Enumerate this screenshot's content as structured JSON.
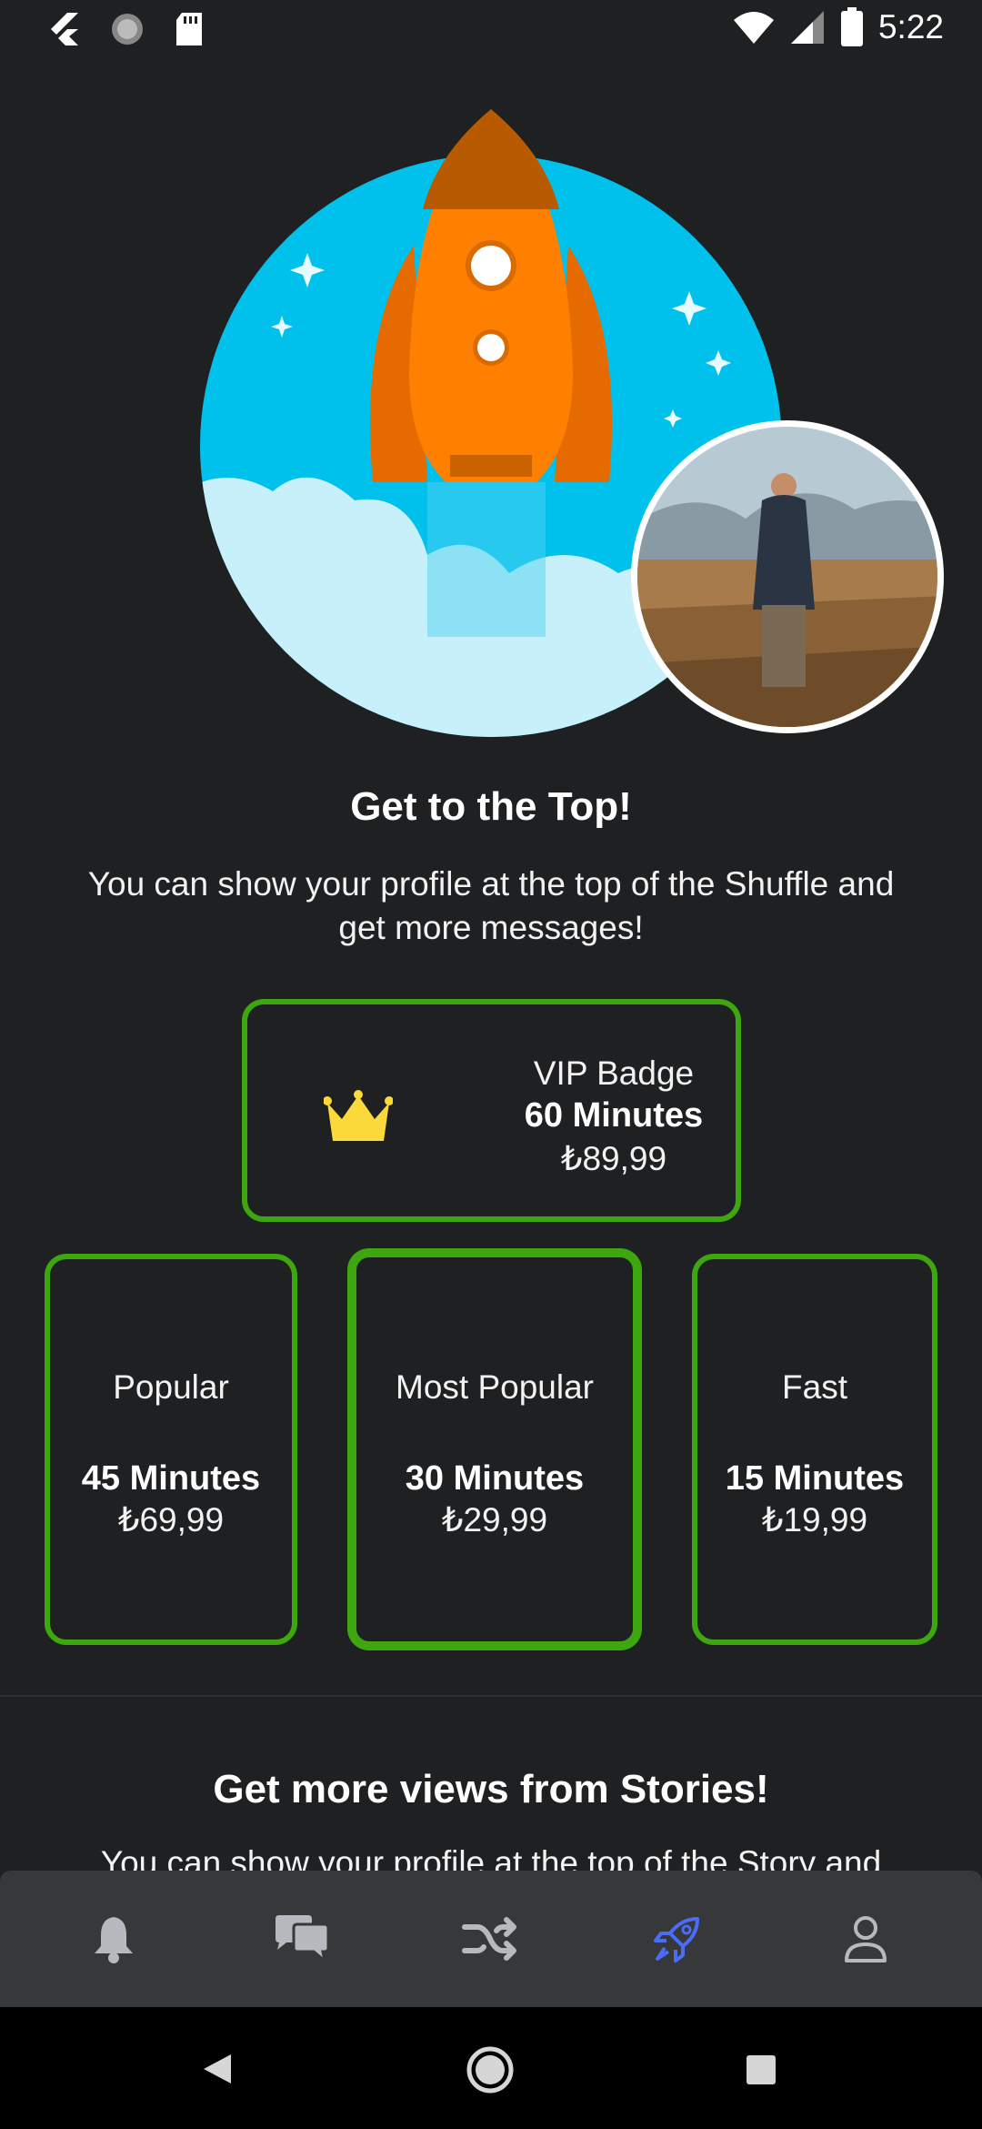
{
  "status_bar": {
    "time": "5:22"
  },
  "promo": {
    "title": "Get to the Top!",
    "description": "You can show your profile at the top of the Shuffle and get more messages!"
  },
  "vip": {
    "label": "VIP Badge",
    "duration": "60 Minutes",
    "price": "₺89,99"
  },
  "plans": [
    {
      "label": "Popular",
      "duration": "45 Minutes",
      "price": "₺69,99"
    },
    {
      "label": "Most Popular",
      "duration": "30 Minutes",
      "price": "₺29,99"
    },
    {
      "label": "Fast",
      "duration": "15 Minutes",
      "price": "₺19,99"
    }
  ],
  "stories": {
    "title": "Get more views from Stories!",
    "description": "You can show your profile at the top of the Story and"
  },
  "bottom_nav": [
    "bell-icon",
    "chat-icon",
    "shuffle-icon",
    "rocket-icon",
    "profile-icon"
  ],
  "colors": {
    "accent": "#3ea60f",
    "active_nav": "#4a6cf7",
    "background": "#1e2022"
  }
}
